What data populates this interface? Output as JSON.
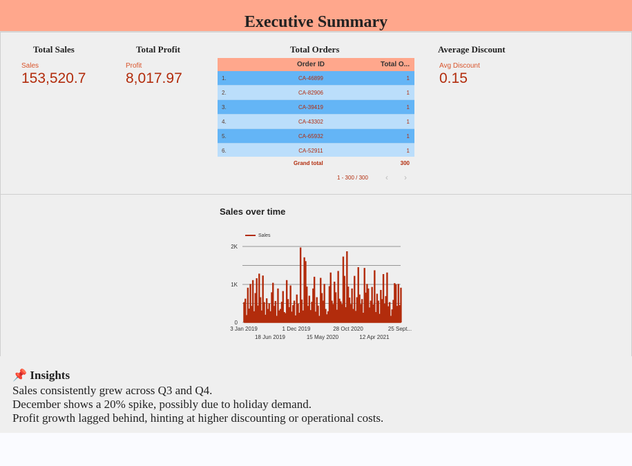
{
  "header": {
    "title": "Executive Summary"
  },
  "kpis": {
    "sales": {
      "title": "Total Sales",
      "label": "Sales",
      "value": "153,520.7"
    },
    "profit": {
      "title": "Total Profit",
      "label": "Profit",
      "value": "8,017.97"
    },
    "discount": {
      "title": "Average Discount",
      "label": "Avg Discount",
      "value": "0.15"
    }
  },
  "orders_table": {
    "title": "Total Orders",
    "col1": "Order ID",
    "col2": "Total O...",
    "rows": [
      {
        "idx": "1.",
        "id": "CA-46899",
        "total": "1"
      },
      {
        "idx": "2.",
        "id": "CA-82906",
        "total": "1"
      },
      {
        "idx": "3.",
        "id": "CA-39419",
        "total": "1"
      },
      {
        "idx": "4.",
        "id": "CA-43302",
        "total": "1"
      },
      {
        "idx": "5.",
        "id": "CA-65932",
        "total": "1"
      },
      {
        "idx": "6.",
        "id": "CA-52911",
        "total": "1"
      }
    ],
    "grand_label": "Grand total",
    "grand_value": "300",
    "pager": "1 - 300 / 300",
    "prev_icon": "chevron-left-icon",
    "next_icon": "chevron-right-icon"
  },
  "chart_data": {
    "type": "line",
    "title": "Sales over time",
    "series": [
      {
        "name": "Sales",
        "color": "#b22c0c"
      }
    ],
    "y_ticks": [
      "0",
      "1K",
      "2K"
    ],
    "ylim": [
      0,
      2000
    ],
    "x_ticks_top": [
      "3 Jan 2019",
      "1 Dec 2019",
      "28 Oct 2020",
      "25 Sept..."
    ],
    "x_ticks_bottom": [
      "18 Jun 2019",
      "15 May 2020",
      "12 Apr 2021"
    ],
    "approx_values": [
      520,
      610,
      180,
      900,
      350,
      1000,
      420,
      1100,
      280,
      760,
      1150,
      430,
      1270,
      650,
      300,
      1220,
      520,
      190,
      620,
      340,
      490,
      280,
      780,
      1030,
      420,
      550,
      160,
      880,
      300,
      340,
      530,
      810,
      260,
      230,
      1100,
      600,
      390,
      960,
      270,
      440,
      560,
      170,
      720,
      480,
      240,
      1960,
      590,
      300,
      1700,
      1600,
      930,
      420,
      690,
      310,
      530,
      880,
      1190,
      270,
      650,
      430,
      160,
      1160,
      760,
      560,
      1000,
      340,
      200,
      280,
      940,
      1300,
      560,
      470,
      1060,
      780,
      320,
      1340,
      610,
      540,
      470,
      1720,
      1210,
      390,
      1860,
      930,
      640,
      470,
      880,
      340,
      1210,
      290,
      650,
      1440,
      720,
      470,
      600,
      240,
      1420,
      770,
      1000,
      880,
      380,
      560,
      920,
      460,
      1360,
      260,
      740,
      560,
      210,
      840,
      600,
      1260,
      480,
      680,
      1300,
      410,
      520,
      160,
      330,
      580,
      1020,
      990,
      420,
      1000,
      440,
      900
    ]
  },
  "insights": {
    "heading": "Insights",
    "pin_icon": "pushpin-icon",
    "lines": [
      "Sales consistently grew across Q3 and Q4.",
      "December shows a 20% spike, possibly due to holiday demand.",
      "Profit growth lagged behind, hinting at higher discounting or operational costs."
    ]
  }
}
